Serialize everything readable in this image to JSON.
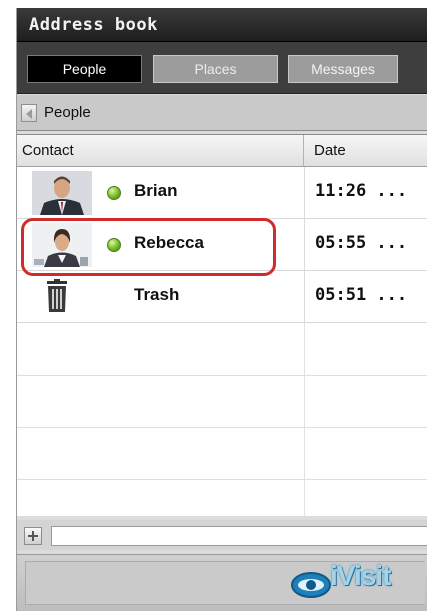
{
  "window": {
    "title": "Address book"
  },
  "tabs": [
    {
      "label": "People",
      "selected": true
    },
    {
      "label": "Places",
      "selected": false
    },
    {
      "label": "Messages",
      "selected": false
    }
  ],
  "breadcrumb": {
    "label": "People"
  },
  "table": {
    "columns": [
      "Contact",
      "Date"
    ],
    "rows": [
      {
        "name": "Brian",
        "date": "11:26 ...",
        "status": "online",
        "icon": "avatar-man"
      },
      {
        "name": "Rebecca",
        "date": "05:55 ...",
        "status": "online",
        "icon": "avatar-woman"
      },
      {
        "name": "Trash",
        "date": "05:51 ...",
        "status": "none",
        "icon": "trash-icon"
      }
    ]
  },
  "input": {
    "value": ""
  },
  "footer": {
    "logo_text": "iVisit"
  },
  "colors": {
    "title_bg": "#1e1e1e",
    "selected_tab": "#000000",
    "status_online": "#7bbf2a",
    "highlight": "#d22a2a",
    "logo": "#2a86b9"
  }
}
